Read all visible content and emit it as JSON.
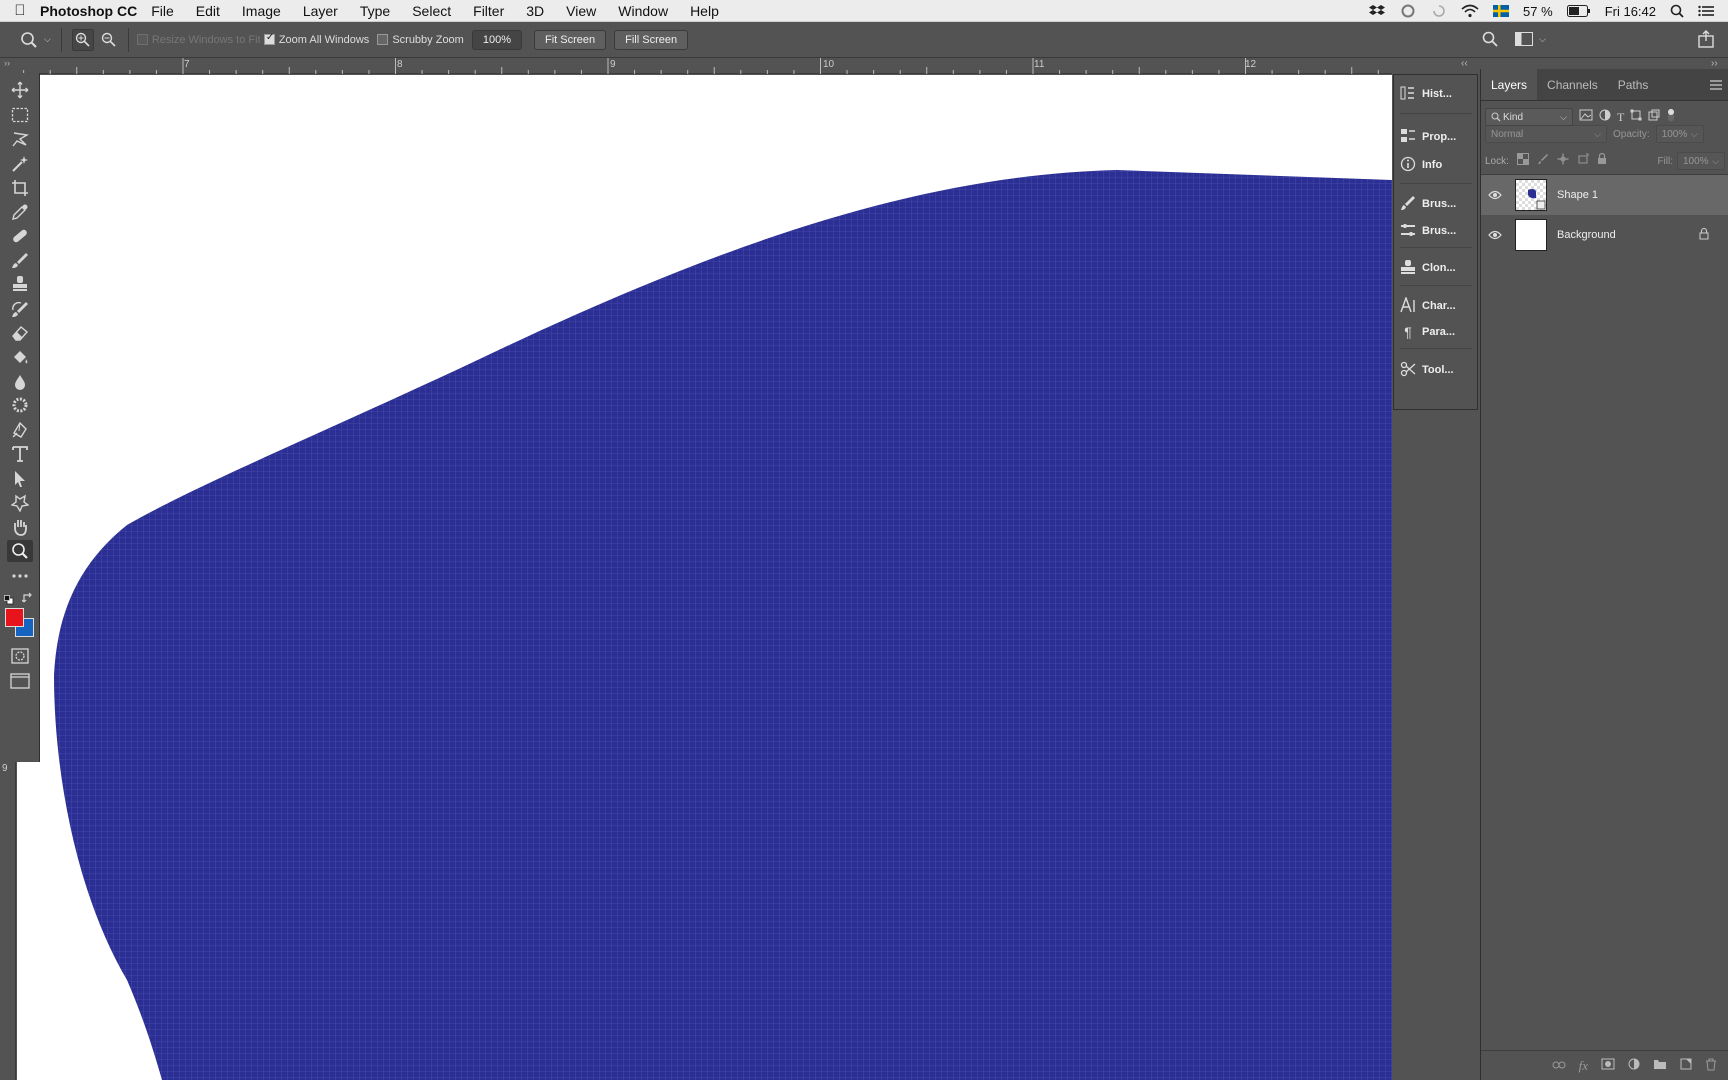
{
  "menubar": {
    "app_name": "Photoshop CC",
    "menus": [
      "File",
      "Edit",
      "Image",
      "Layer",
      "Type",
      "Select",
      "Filter",
      "3D",
      "View",
      "Window",
      "Help"
    ],
    "battery": "57 %",
    "clock": "Fri 16:42"
  },
  "options": {
    "resize_windows": "Resize Windows to Fit",
    "zoom_all_windows": "Zoom All Windows",
    "scrubby_zoom": "Scrubby Zoom",
    "zoom_value": "100%",
    "fit_screen": "Fit Screen",
    "fill_screen": "Fill Screen"
  },
  "rulers": {
    "top_labels": [
      "7",
      "8",
      "9",
      "10",
      "11",
      "12"
    ],
    "left_label": "9"
  },
  "dock": {
    "items": [
      "Hist...",
      "Prop...",
      "Info",
      "Brus...",
      "Brus...",
      "Clon...",
      "Char...",
      "Para...",
      "Tool..."
    ]
  },
  "layers_panel": {
    "tabs": [
      "Layers",
      "Channels",
      "Paths"
    ],
    "filter_kind": "Kind",
    "blend_mode": "Normal",
    "opacity_label": "Opacity:",
    "opacity_value": "100%",
    "lock_label": "Lock:",
    "fill_label": "Fill:",
    "fill_value": "100%",
    "layers": [
      {
        "name": "Shape 1"
      },
      {
        "name": "Background"
      }
    ]
  },
  "colors": {
    "foreground": "#e8141c",
    "background": "#1565c0",
    "shape_fill": "#2b2f94"
  }
}
